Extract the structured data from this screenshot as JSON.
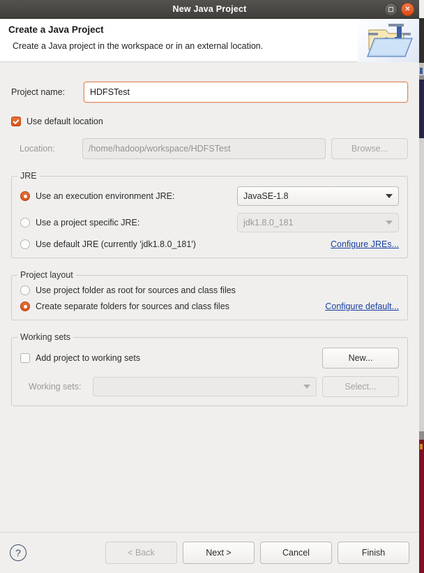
{
  "window": {
    "title": "New Java Project",
    "maximize_icon": "maximize-icon",
    "close_icon": "close-icon",
    "close_glyph": "×"
  },
  "header": {
    "title": "Create a Java Project",
    "description": "Create a Java project in the workspace or in an external location.",
    "icon": "java-project-folder-icon"
  },
  "project": {
    "name_label": "Project name:",
    "name_value": "HDFSTest",
    "use_default_location_label": "Use default location",
    "use_default_location_checked": true,
    "location_label": "Location:",
    "location_value": "/home/hadoop/workspace/HDFSTest",
    "browse_label": "Browse..."
  },
  "jre": {
    "group_title": "JRE",
    "options": [
      {
        "label": "Use an execution environment JRE:",
        "selected": true,
        "combo_value": "JavaSE-1.8",
        "combo_enabled": true
      },
      {
        "label": "Use a project specific JRE:",
        "selected": false,
        "combo_value": "jdk1.8.0_181",
        "combo_enabled": false
      },
      {
        "label": "Use default JRE (currently 'jdk1.8.0_181')",
        "selected": false
      }
    ],
    "configure_link": "Configure JREs..."
  },
  "project_layout": {
    "group_title": "Project layout",
    "options": [
      {
        "label": "Use project folder as root for sources and class files",
        "selected": false
      },
      {
        "label": "Create separate folders for sources and class files",
        "selected": true
      }
    ],
    "configure_link": "Configure default..."
  },
  "working_sets": {
    "group_title": "Working sets",
    "add_label": "Add project to working sets",
    "add_checked": false,
    "new_label": "New...",
    "sets_label": "Working sets:",
    "sets_value": "",
    "select_label": "Select..."
  },
  "footer": {
    "help_icon": "help-icon",
    "help_glyph": "?",
    "back_label": "< Back",
    "back_enabled": false,
    "next_label": "Next >",
    "cancel_label": "Cancel",
    "finish_label": "Finish"
  },
  "colors": {
    "accent_orange": "#d8531a",
    "titlebar": "#4a4844",
    "dialog_bg": "#f0efee",
    "link_blue": "#1a3fa0"
  }
}
